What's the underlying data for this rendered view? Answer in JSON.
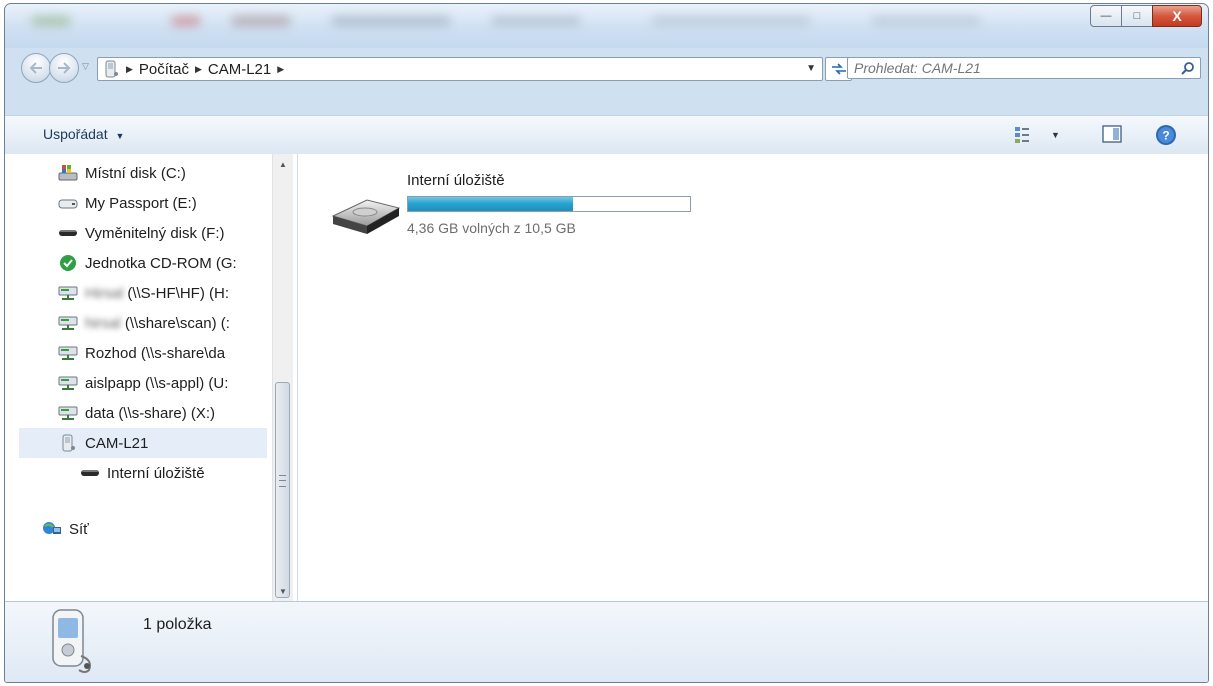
{
  "window": {
    "controls": {
      "minimize": "—",
      "maximize": "□",
      "close": "X"
    }
  },
  "navigation": {
    "back_icon": "back-arrow-icon",
    "forward_icon": "forward-arrow-icon",
    "breadcrumb": [
      "Počítač",
      "CAM-L21"
    ],
    "refresh_icon": "refresh-icon",
    "search_placeholder": "Prohledat: CAM-L21"
  },
  "toolbar": {
    "organize_label": "Uspořádat",
    "icons": [
      "view-options-icon",
      "preview-pane-icon",
      "help-icon"
    ]
  },
  "sidebar": {
    "items": [
      {
        "label": "Místní disk (C:)",
        "icon": "local-disk-icon"
      },
      {
        "label": "My Passport (E:)",
        "icon": "external-drive-icon"
      },
      {
        "label": "Vyměnitelný disk (F:)",
        "icon": "removable-drive-icon"
      },
      {
        "label": "Jednotka CD-ROM (G:",
        "icon": "cdrom-icon"
      },
      {
        "prefix": "Hirsal",
        "label": "(\\\\S-HF\\HF) (H:",
        "icon": "network-drive-icon"
      },
      {
        "prefix": "hirsal",
        "label": "(\\\\share\\scan) (:",
        "icon": "network-drive-icon"
      },
      {
        "label": "Rozhod (\\\\s-share\\da",
        "icon": "network-drive-icon"
      },
      {
        "label": "aislpapp (\\\\s-appl) (U:",
        "icon": "network-drive-icon"
      },
      {
        "label": "data (\\\\s-share) (X:)",
        "icon": "network-drive-icon"
      },
      {
        "label": "CAM-L21",
        "icon": "phone-device-icon",
        "selected": true
      },
      {
        "label": "Interní úložiště",
        "icon": "internal-storage-icon"
      },
      {
        "label": "Síť",
        "icon": "network-icon"
      }
    ]
  },
  "content": {
    "drive": {
      "name": "Interní úložiště",
      "free_text": "4,36 GB volných z 10,5 GB",
      "used_fraction": 0.585,
      "icon": "drive-icon"
    }
  },
  "details": {
    "count": "1 položka",
    "icon": "phone-device-icon"
  },
  "colors": {
    "capacity_fill": "#25a1cf",
    "close_button": "#c13b20",
    "selected_item": "#e5eef8"
  }
}
